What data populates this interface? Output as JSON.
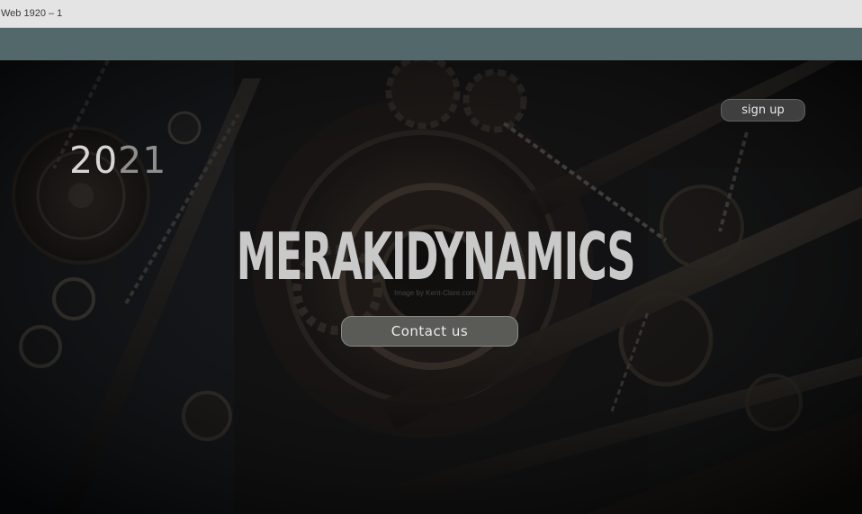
{
  "window": {
    "title": "Web 1920 – 1"
  },
  "hero": {
    "year_main": "20",
    "year_dim": "21",
    "brand": "MERAKIDYNAMICS",
    "watermark": "Image by Kent-Clare.com",
    "contact_label": "Contact us",
    "signup_label": "sign up"
  },
  "colors": {
    "header_bar": "#52686b",
    "hero_background": "#0c0d0f",
    "button_contact": "#5a5a56",
    "button_signup": "#3f3f3f"
  }
}
